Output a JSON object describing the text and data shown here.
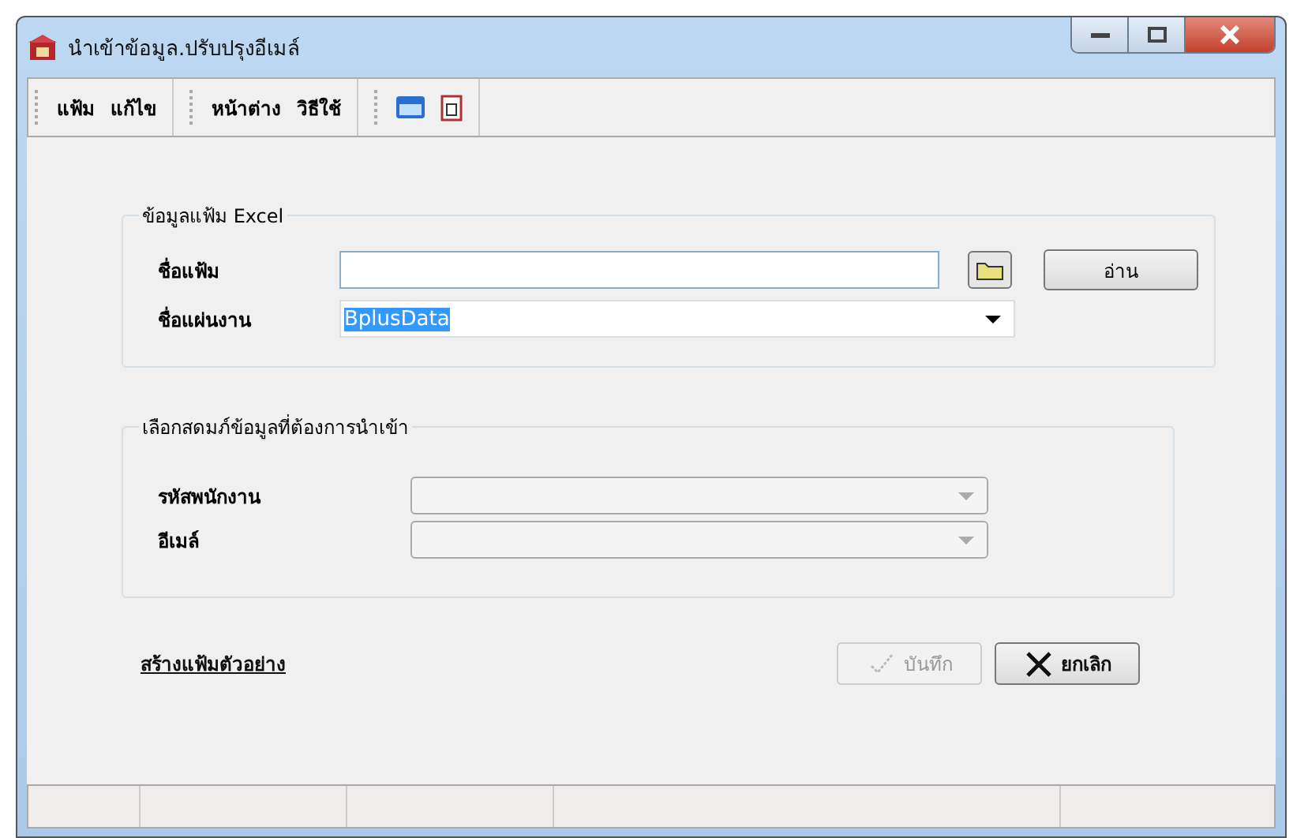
{
  "window": {
    "title": "นำเข้าข้อมูล.ปรับปรุงอีเมล์"
  },
  "menu": [
    {
      "label": "แฟ้ม"
    },
    {
      "label": "แก้ไข"
    },
    {
      "label": "หน้าต่าง"
    },
    {
      "label": "วิธีใช้"
    }
  ],
  "excel_group": {
    "title": "ข้อมูลแฟ้ม Excel",
    "file_label": "ชื่อแฟ้ม",
    "read_button": "อ่าน",
    "sheet_label": "ชื่อแผ่นงาน",
    "sheet_value": "BplusData"
  },
  "columns_group": {
    "title": "เลือกสดมภ์ข้อมูลที่ต้องการนำเข้า",
    "fields": [
      {
        "label": "รหัสพนักงาน",
        "disabled": true
      },
      {
        "label": "อีเมล์",
        "disabled": true
      }
    ]
  },
  "sample_link": "สร้างแฟ้มตัวอย่าง",
  "buttons": [
    {
      "kind": "save",
      "label": "บันทึก",
      "disabled": true
    },
    {
      "kind": "cancel",
      "label": "ยกเลิก",
      "disabled": false
    }
  ]
}
